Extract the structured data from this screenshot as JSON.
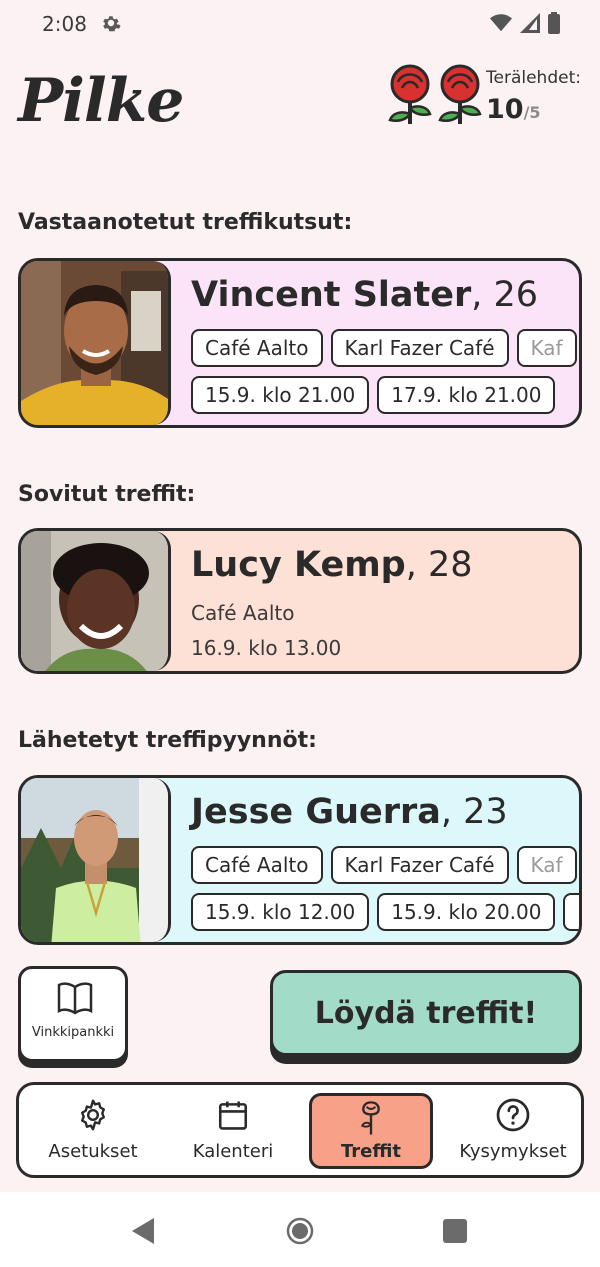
{
  "status": {
    "time": "2:08"
  },
  "header": {
    "logo": "Pilke",
    "petals_label": "Terälehdet:",
    "petals_value": "10",
    "petals_max": "/5"
  },
  "sections": {
    "received": "Vastaanotetut treffikutsut:",
    "agreed": "Sovitut treffit:",
    "sent": "Lähetetyt treffipyynnöt:"
  },
  "cards": {
    "received": {
      "name": "Vincent Slater",
      "age": ", 26",
      "places": [
        "Café Aalto",
        "Karl Fazer Café",
        "Kaf"
      ],
      "times": [
        "15.9. klo 21.00",
        "17.9. klo 21.00"
      ],
      "bg": "#fbe4f8"
    },
    "agreed": {
      "name": "Lucy Kemp",
      "age": ", 28",
      "place": "Café Aalto",
      "time": "16.9. klo 13.00",
      "bg": "#fde0d6"
    },
    "sent": {
      "name": "Jesse Guerra",
      "age": ", 23",
      "places": [
        "Café Aalto",
        "Karl Fazer Café",
        "Kaf"
      ],
      "times": [
        "15.9. klo 12.00",
        "15.9. klo 20.00"
      ],
      "bg": "#dcf8fb"
    }
  },
  "actions": {
    "tips": "Vinkkipankki",
    "find": "Löydä treffit!"
  },
  "nav": {
    "items": [
      {
        "label": "Asetukset",
        "icon": "gear-icon"
      },
      {
        "label": "Kalenteri",
        "icon": "calendar-icon"
      },
      {
        "label": "Treffit",
        "icon": "rose-icon"
      },
      {
        "label": "Kysymykset",
        "icon": "question-icon"
      }
    ],
    "active_index": 2,
    "active_color": "#f7a189"
  }
}
